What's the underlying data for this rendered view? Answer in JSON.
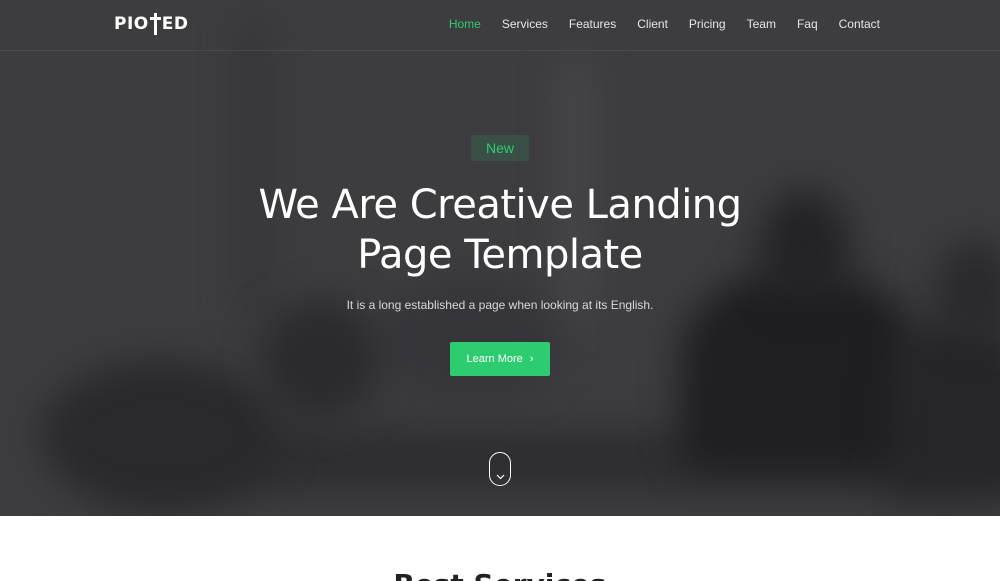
{
  "brand": {
    "logo_text_left": "PIO",
    "logo_text_right": "ED"
  },
  "nav": {
    "items": [
      {
        "label": "Home",
        "active": true
      },
      {
        "label": "Services",
        "active": false
      },
      {
        "label": "Features",
        "active": false
      },
      {
        "label": "Client",
        "active": false
      },
      {
        "label": "Pricing",
        "active": false
      },
      {
        "label": "Team",
        "active": false
      },
      {
        "label": "Faq",
        "active": false
      },
      {
        "label": "Contact",
        "active": false
      }
    ]
  },
  "hero": {
    "badge": "New",
    "title_line1": "We Are Creative Landing",
    "title_line2": "Page Template",
    "subtitle": "It is a long established a page when looking at its English.",
    "cta_label": "Learn More",
    "cta_icon": "chevron-right-icon",
    "scroll_icon": "mouse-scroll-icon"
  },
  "next_section": {
    "title_light": "Best ",
    "title_bold": "Services"
  },
  "colors": {
    "accent": "#2ecc71",
    "hero_overlay": "#3d3c3f",
    "text_light": "#ffffff"
  }
}
